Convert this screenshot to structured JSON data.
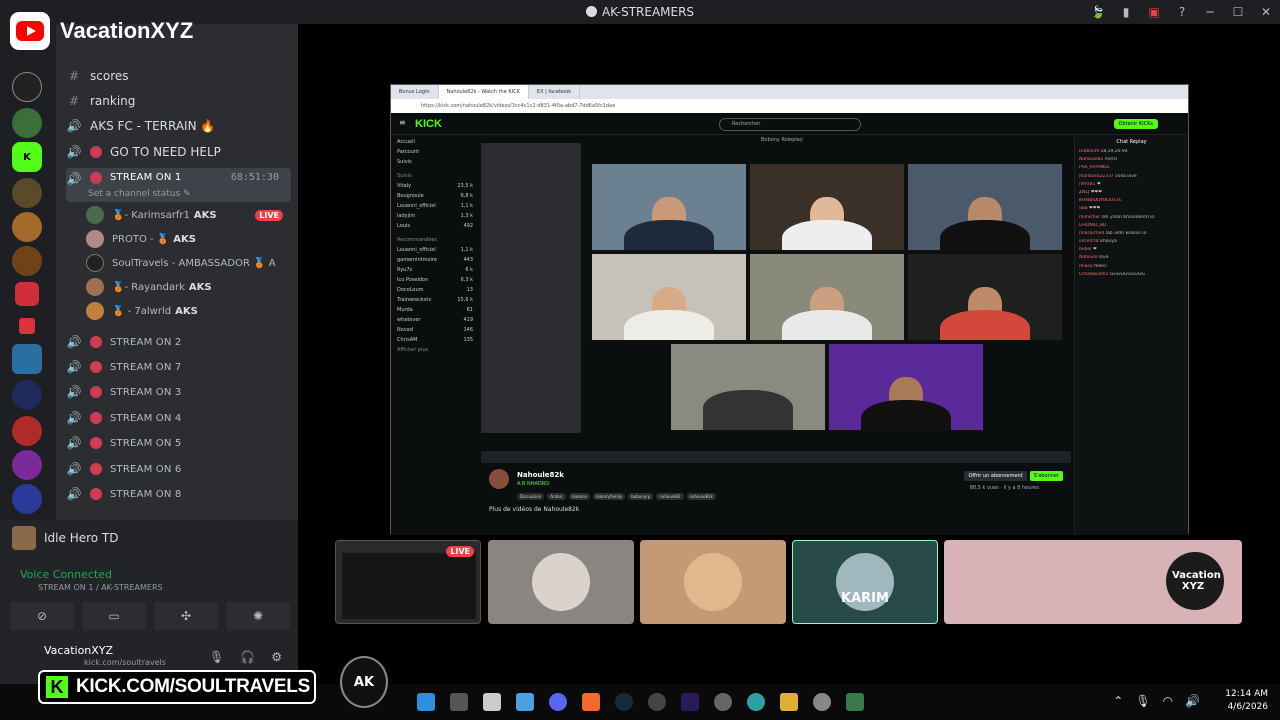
{
  "window": {
    "title": "AK-STREAMERS",
    "controls": [
      "─",
      "☐",
      "✕"
    ]
  },
  "brand": {
    "name": "VacationXYZ"
  },
  "channels": [
    {
      "type": "text",
      "label": "scores"
    },
    {
      "type": "text",
      "label": "ranking"
    },
    {
      "type": "voice",
      "label": "AKS FC - TERRAIN 🔥"
    },
    {
      "type": "voice",
      "label": "GO TO NEED HELP"
    },
    {
      "type": "voice",
      "label": "STREAM ON 1",
      "time": "68:51:30",
      "status": "Set a channel status ✎"
    }
  ],
  "stream1_users": [
    {
      "name": "🥉- Karimsarfr1",
      "tag": "AKS",
      "live": "LIVE"
    },
    {
      "name": "PROTO - 🥉",
      "tag": "AKS"
    },
    {
      "name": "SoulTravels - AMBASSADOR 🥉 A",
      "tag": ""
    },
    {
      "name": "🥉- Rayandark",
      "tag": "AKS"
    },
    {
      "name": "🥉 - 7alwrld",
      "tag": "AKS"
    }
  ],
  "stream_channels": [
    "STREAM ON 2",
    "STREAM ON 7",
    "STREAM ON 3",
    "STREAM ON 4",
    "STREAM ON 5",
    "STREAM ON 6",
    "STREAM ON 8"
  ],
  "bottom": {
    "activity": "Idle Hero TD",
    "voice_status": "Voice Connected",
    "voice_channel": "STREAM ON 1 / AK-STREAMERS",
    "username": "VacationXYZ",
    "user_sub": "kick.com/soultravels"
  },
  "browser": {
    "tabs": [
      "Bonus Login",
      "Nahoule82k - Watch the KICK",
      "EX | facebook"
    ],
    "address": "https://kick.com/nahoule82k/videos/3cc4c1c2-d831-4f0a-abd7-7dd6a5fc1dae"
  },
  "kick": {
    "logo": "KICK",
    "search_placeholder": "Rechercher",
    "get_btn": "Obtenir KICKs",
    "nav": [
      "Accueil",
      "Parcourir",
      "Suivis"
    ],
    "followed_label": "Suivis",
    "followed": [
      {
        "name": "Vitaly",
        "count": "23,5 k"
      },
      {
        "name": "Bougnoule",
        "count": "6,8 k"
      },
      {
        "name": "Louanni_officiel",
        "count": "1,1 k"
      },
      {
        "name": "ladyjim",
        "count": "1,3 k"
      },
      {
        "name": "Louis",
        "count": "492"
      }
    ],
    "recommended_label": "Recommandées",
    "recommended": [
      {
        "name": "Louanni_officiel",
        "count": "1,1 k"
      },
      {
        "name": "gamemintmoire",
        "count": "443"
      },
      {
        "name": "Ryu7z",
        "count": "6 k"
      },
      {
        "name": "Ico Poseidon",
        "count": "6,3 k"
      },
      {
        "name": "DocoLoum",
        "count": "13"
      },
      {
        "name": "Trainwreckstv",
        "count": "15,6 k"
      },
      {
        "name": "Murda",
        "count": "61"
      },
      {
        "name": "whatever",
        "count": "419"
      },
      {
        "name": "Novad",
        "count": "146"
      },
      {
        "name": "ChrisAM",
        "count": "135"
      }
    ],
    "show_more": "Afficher plus",
    "stream_title": "Bobony Roleplay",
    "streamer": "Nahoule82k",
    "category": "A.B NHAORO",
    "tags": [
      "Discussion",
      "Arabic",
      "bobona",
      "boboryfamily",
      "bobonyrp",
      "nahoule82",
      "nahoule82k"
    ],
    "subscribe": "Offrir un abonnement",
    "follow": "S'abonner",
    "views": "88,5 k vues · Il y a 8 heures",
    "more_videos": "Plus de vidéos de Nahoule82k",
    "chat_title": "Chat Replay"
  },
  "chat_messages": [
    {
      "user": "Diablo49",
      "text": "18,19,20,94"
    },
    {
      "user": "Nahoule82",
      "text": "merci"
    },
    {
      "user": "PSK_RAYANEE",
      "text": ""
    },
    {
      "user": "marlboro22337",
      "text": "voilà love"
    },
    {
      "user": "nfmr81",
      "text": "❤"
    },
    {
      "user": "ZNLJ",
      "text": "❤❤❤"
    },
    {
      "user": "KRAIBIDDYBOOSTE",
      "text": ""
    },
    {
      "user": "Sbb",
      "text": "❤❤❤"
    },
    {
      "user": "mimicher",
      "text": "lah yslah bhooliberm lo"
    },
    {
      "user": "GHONID_BD",
      "text": ""
    },
    {
      "user": "mlasarmed",
      "text": "lab adm walsoo lo"
    },
    {
      "user": "intrinfrat",
      "text": "khouya"
    },
    {
      "user": "bebel",
      "text": "❤"
    },
    {
      "user": "Nahoule",
      "text": "love"
    },
    {
      "user": "mikoo",
      "text": "merci"
    },
    {
      "user": "Chadow2001",
      "text": "GGGGGGGGGG"
    }
  ],
  "tiles": [
    {
      "name": "screen-share",
      "live": "LIVE",
      "bg": "#2a2a2a"
    },
    {
      "name": "participant-2",
      "bg": "#8a8580",
      "face": "#d9d3cc"
    },
    {
      "name": "participant-3",
      "bg": "#c49a76",
      "face": "#e0b88e"
    },
    {
      "name": "participant-karim",
      "label": "KARIM",
      "bg": "#284b4a",
      "face": "#9fb7bd"
    },
    {
      "name": "participant-vacation",
      "label": "Vacation XYZ",
      "bg": "#d7b3b8",
      "face": "#1b1b1b"
    }
  ],
  "overlay": {
    "kick_url": "KICK.COM/SOULTRAVELS",
    "ak_text": "AK"
  },
  "taskbar": {
    "time": "12:14 AM",
    "date": "4/6/2026"
  }
}
